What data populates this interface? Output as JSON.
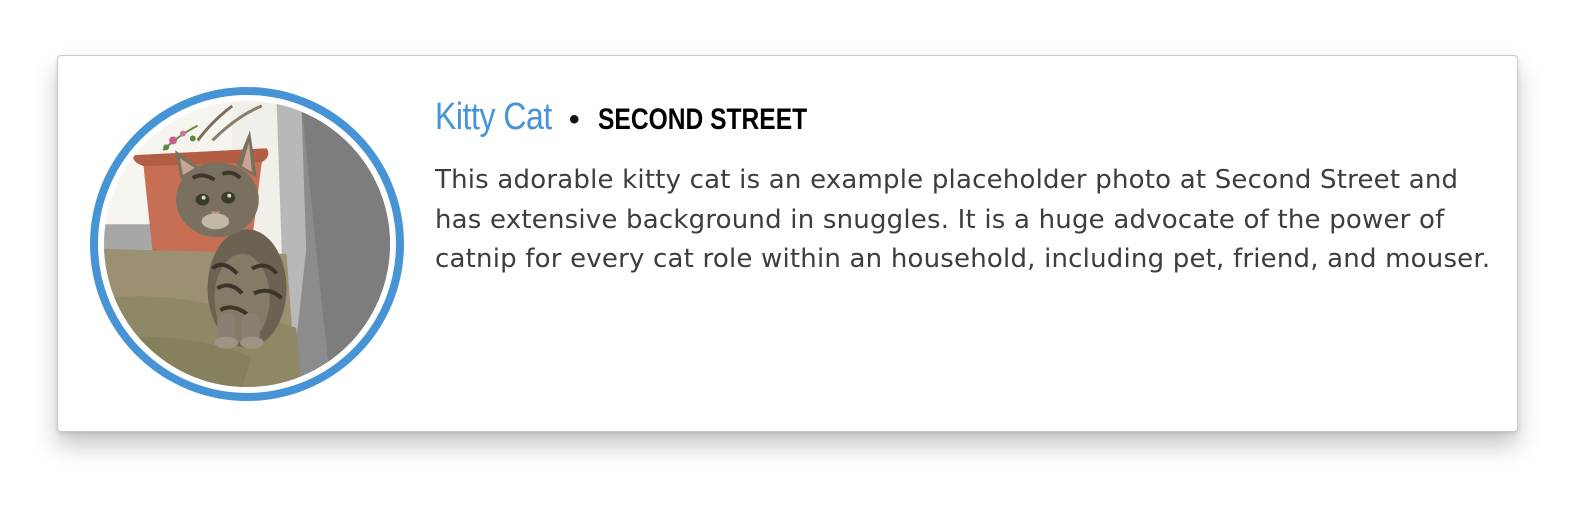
{
  "profile": {
    "name": "Kitty Cat",
    "separator": "•",
    "organization": "SECOND STREET",
    "bio": "This adorable kitty cat is an example placeholder photo at Second Street and has extensive background in snuggles. It is a huge advocate of the power of catnip for every cat role within an household, including pet, friend, and mouser.",
    "photo": "tabby-kitten-photo"
  },
  "colors": {
    "accent": "#4694d6",
    "text": "#3d3d3d",
    "card_border": "#c9c9c9"
  }
}
